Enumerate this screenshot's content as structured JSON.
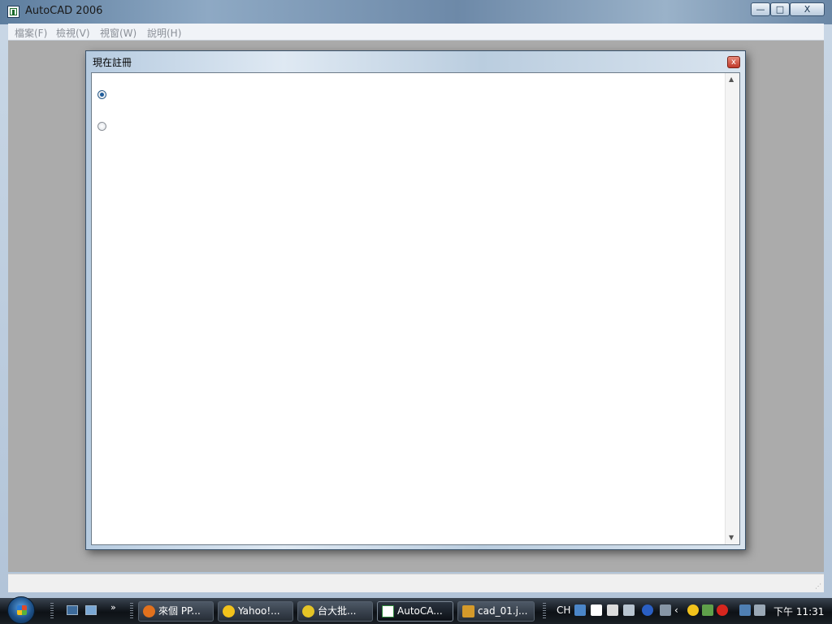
{
  "window": {
    "title": "AutoCAD 2006",
    "controls": {
      "minimize": "—",
      "maximize": "□",
      "close": "X"
    }
  },
  "menu": [
    "檔案(F)",
    "檢視(V)",
    "視窗(W)",
    "說明(H)"
  ],
  "dialog": {
    "title": "現在註冊",
    "close": "x",
    "options": [
      {
        "checked": true
      },
      {
        "checked": false
      }
    ],
    "scroll_up": "▲",
    "scroll_down": "▼"
  },
  "taskbar": {
    "quicklaunch_more": "»",
    "buttons": [
      {
        "label": "來個 PP...",
        "icon": "firefox-icon",
        "color": "#e2711d"
      },
      {
        "label": "Yahoo!...",
        "icon": "yahoo-messenger-icon",
        "color": "#f2c21b"
      },
      {
        "label": "台大批...",
        "icon": "search-icon",
        "color": "#e5c426"
      },
      {
        "label": "AutoCA...",
        "icon": "autocad-icon",
        "color": "#2f8a3c",
        "active": true
      },
      {
        "label": "cad_01.j...",
        "icon": "paint-icon",
        "color": "#d59a2a"
      }
    ],
    "tray": {
      "language": "CH",
      "clock": "下午 11:31"
    }
  },
  "colors": {
    "client_bg": "#ababab",
    "dialog_close": "#c0392b",
    "taskbar": "#0d1116"
  }
}
